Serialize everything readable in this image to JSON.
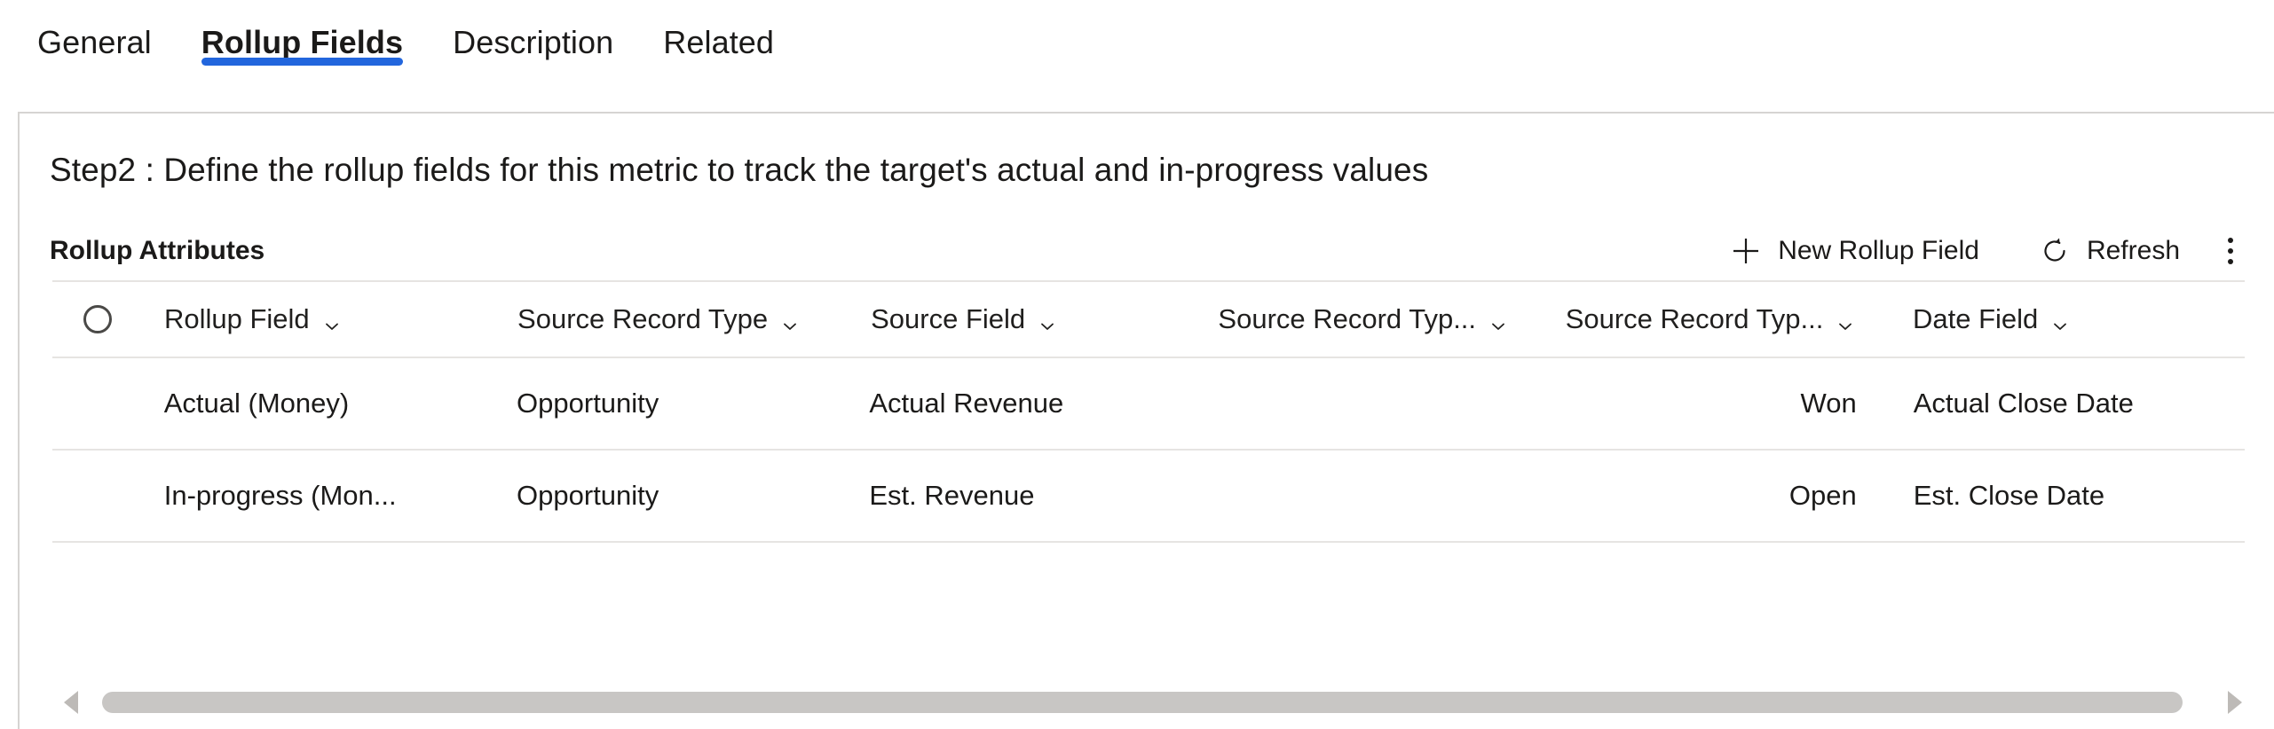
{
  "tabs": [
    {
      "label": "General",
      "selected": false
    },
    {
      "label": "Rollup Fields",
      "selected": true
    },
    {
      "label": "Description",
      "selected": false
    },
    {
      "label": "Related",
      "selected": false
    }
  ],
  "panel": {
    "step_text": "Step2 : Define the rollup fields for this metric to track the target's actual and in-progress values",
    "section_title": "Rollup Attributes"
  },
  "toolbar": {
    "new_rollup_field_label": "New Rollup Field",
    "new_rollup_field_icon": "plus-icon",
    "refresh_label": "Refresh",
    "refresh_icon": "refresh-icon",
    "overflow_icon": "more-vertical-icon"
  },
  "grid": {
    "select_all_icon": "select-all-circle-icon",
    "columns": [
      {
        "label": "Rollup Field",
        "caret": "chevron-down-icon"
      },
      {
        "label": "Source Record Type",
        "caret": "chevron-down-icon"
      },
      {
        "label": "Source Field",
        "caret": "chevron-down-icon"
      },
      {
        "label": "Source Record Typ...",
        "caret": "chevron-down-icon"
      },
      {
        "label": "Source Record Typ...",
        "caret": "chevron-down-icon"
      },
      {
        "label": "Date Field",
        "caret": "chevron-down-icon"
      }
    ],
    "rows": [
      {
        "rollup_field": "Actual (Money)",
        "source_record_type": "Opportunity",
        "source_field": "Actual Revenue",
        "source_record_type_2": "",
        "source_record_type_3": "Won",
        "date_field": "Actual Close Date"
      },
      {
        "rollup_field": "In-progress (Mon...",
        "source_record_type": "Opportunity",
        "source_field": "Est. Revenue",
        "source_record_type_2": "",
        "source_record_type_3": "Open",
        "date_field": "Est. Close Date"
      }
    ]
  },
  "scrollbar": {
    "left_arrow_icon": "scroll-left-arrow-icon",
    "right_arrow_icon": "scroll-right-arrow-icon"
  },
  "colors": {
    "accent": "#2266dd",
    "text": "#1b1a19",
    "divider": "#e6e4e2",
    "panel_border": "#d6d4d2",
    "scrollbar_thumb": "#c8c6c4"
  }
}
